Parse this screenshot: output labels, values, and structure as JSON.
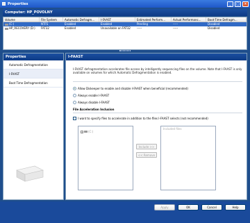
{
  "window": {
    "title": "Properties"
  },
  "computer": {
    "label": "Computer: HP_POVOLNY"
  },
  "volumes": {
    "columns": [
      "Volume",
      "File System",
      "Automatic Defragm...",
      "I-FAAST",
      "Estimated Perform...",
      "Actual Performanc...",
      "Boot-Time Defragm..."
    ],
    "rows": [
      {
        "volume": "(C:)",
        "fs": "NTFS",
        "auto": "Enabled",
        "ifaast": "Enabled",
        "est": "Pending",
        "actual": "-----",
        "boot": "Disabled"
      },
      {
        "volume": "HP_RECOVERY (D:)",
        "fs": "FAT32",
        "auto": "Enabled",
        "ifaast": "Unavailable on FAT32",
        "est": "-----",
        "actual": "-----",
        "boot": "Disabled"
      }
    ]
  },
  "sidebar": {
    "title": "Properties",
    "items": [
      "Automatic Defragmentation",
      "I-FAAST",
      "Boot Time Defragmentation"
    ]
  },
  "main": {
    "title": "I-FAAST",
    "description": "I-FAAST defragmentation accelerates file access by intelligently sequencing files on the volume. Note that I-FAAST is only available on volumes for which Automatic Defragmentation is enabled.",
    "options": [
      "Allow Diskeeper to enable and disable I-FAAST when beneficial (recommended)",
      "Always enable I-FAAST",
      "Always disable I-FAAST"
    ],
    "section_title": "File Acceleration Inclusion",
    "checkbox_label": "I want to specify files to accelerate in addition to the files I-FAAST selects (not recommended)",
    "tree_root": "(C:)",
    "included_label": "Included files",
    "include_btn": "Include >>",
    "remove_btn": "<< Remove"
  },
  "buttons": {
    "apply": "Apply",
    "ok": "OK",
    "cancel": "Cancel",
    "help": "Help"
  }
}
